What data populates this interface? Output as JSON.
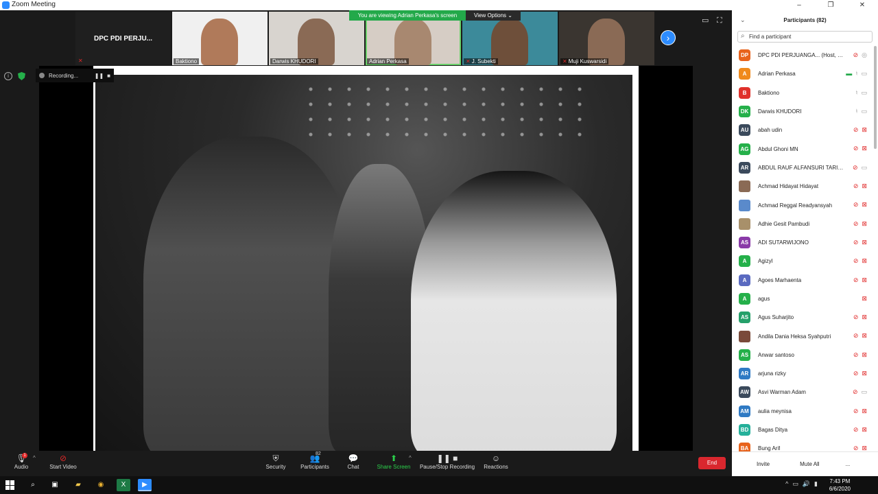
{
  "window": {
    "title": "Zoom Meeting",
    "controls": [
      "–",
      "❐",
      "✕"
    ]
  },
  "banner": {
    "message": "You are viewing Adrian Perkasa's screen",
    "options": "View Options ⌄"
  },
  "thumbs": [
    {
      "name": "DPC PDI PERJU..."
    },
    {
      "name": "Baktiono",
      "mic": "on",
      "skin": "#b07a5a",
      "bg": "#f0f0f0"
    },
    {
      "name": "Darwis KHUDORI",
      "mic": "on",
      "skin": "#8a6a55",
      "bg": "#d8d4cf"
    },
    {
      "name": "Adrian Perkasa",
      "mic": "on",
      "skin": "#a88870",
      "bg": "#d6cdc5"
    },
    {
      "name": "J. Subekti",
      "mic": "off",
      "skin": "#6e4f3a",
      "bg": "#3c8a9a"
    },
    {
      "name": "Muji Kuswarsidi",
      "mic": "off",
      "skin": "#8a6a55",
      "bg": "#3a3530"
    }
  ],
  "recording": {
    "label": "Recording...",
    "pause": "❚❚",
    "stop": "■"
  },
  "toolbar": {
    "audio": "Audio",
    "audio_badge": "1",
    "start_video": "Start Video",
    "security": "Security",
    "participants": "Participants",
    "participants_count": "82",
    "chat": "Chat",
    "share_screen": "Share Screen",
    "pause_recording": "Pause/Stop Recording",
    "reactions": "Reactions",
    "end": "End"
  },
  "panel": {
    "title": "Participants (82)",
    "search_placeholder": "Find a participant",
    "invite": "Invite",
    "mute_all": "Mute All",
    "more": "...",
    "participants": [
      {
        "initials": "DP",
        "color": "#e8631c",
        "name": "DPC PDI PERJUANGA... (Host, me)",
        "mic": "off",
        "cam": "rec"
      },
      {
        "initials": "A",
        "color": "#f08a1c",
        "name": "Adrian Perkasa",
        "mic": "on",
        "cam": "on",
        "share": true
      },
      {
        "initials": "B",
        "color": "#e0312b",
        "name": "Baktiono",
        "mic": "on",
        "cam": "on"
      },
      {
        "initials": "DK",
        "color": "#25b04a",
        "name": "Darwis KHUDORI",
        "mic": "on",
        "cam": "on"
      },
      {
        "initials": "AU",
        "color": "#3b4a5c",
        "name": "abah udin",
        "mic": "off",
        "cam": "off"
      },
      {
        "initials": "AG",
        "color": "#25b04a",
        "name": "Abdul Ghoni MN",
        "mic": "off",
        "cam": "off"
      },
      {
        "initials": "AR",
        "color": "#3b4a5c",
        "name": "ABDUL RAUF ALFANSURI TARIEF...",
        "mic": "off",
        "cam": "on"
      },
      {
        "initials": "",
        "color": "#8a6a55",
        "name": "Achmad Hidayat Hidayat",
        "mic": "off",
        "cam": "off",
        "photo": true
      },
      {
        "initials": "",
        "color": "#5a8acb",
        "name": "Achmad Reggal Readyansyah",
        "mic": "off",
        "cam": "off",
        "photo": true
      },
      {
        "initials": "",
        "color": "#a8906a",
        "name": "Adhie Gesit Pambudi",
        "mic": "off",
        "cam": "off",
        "photo": true
      },
      {
        "initials": "AS",
        "color": "#8a3aa8",
        "name": "ADI SUTARWIJONO",
        "mic": "off",
        "cam": "off"
      },
      {
        "initials": "A",
        "color": "#25b04a",
        "name": "Agizyl",
        "mic": "off",
        "cam": "off"
      },
      {
        "initials": "A",
        "color": "#5a6ac0",
        "name": "Agoes Marhaenta",
        "mic": "off",
        "cam": "off"
      },
      {
        "initials": "A",
        "color": "#25b04a",
        "name": "agus",
        "mic": "none",
        "cam": "off"
      },
      {
        "initials": "AS",
        "color": "#25a06a",
        "name": "Agus Suharjito",
        "mic": "off",
        "cam": "off"
      },
      {
        "initials": "",
        "color": "#7a4a3a",
        "name": "Andila Dania Heksa Syahputri",
        "mic": "off",
        "cam": "off",
        "photo": true
      },
      {
        "initials": "AS",
        "color": "#25b04a",
        "name": "Anwar santoso",
        "mic": "off",
        "cam": "off"
      },
      {
        "initials": "AR",
        "color": "#2f7ac4",
        "name": "arjuna rizky",
        "mic": "off",
        "cam": "off"
      },
      {
        "initials": "AW",
        "color": "#3b4a5c",
        "name": "Asvi Warman Adam",
        "mic": "off",
        "cam": "on"
      },
      {
        "initials": "AM",
        "color": "#2f7ac4",
        "name": "aulia meynisa",
        "mic": "off",
        "cam": "off"
      },
      {
        "initials": "BD",
        "color": "#25b09a",
        "name": "Bagas Ditya",
        "mic": "off",
        "cam": "off"
      },
      {
        "initials": "BA",
        "color": "#e8631c",
        "name": "Bung Arif",
        "mic": "off",
        "cam": "off"
      }
    ]
  },
  "taskbar": {
    "time": "7:43 PM",
    "date": "6/6/2020"
  }
}
